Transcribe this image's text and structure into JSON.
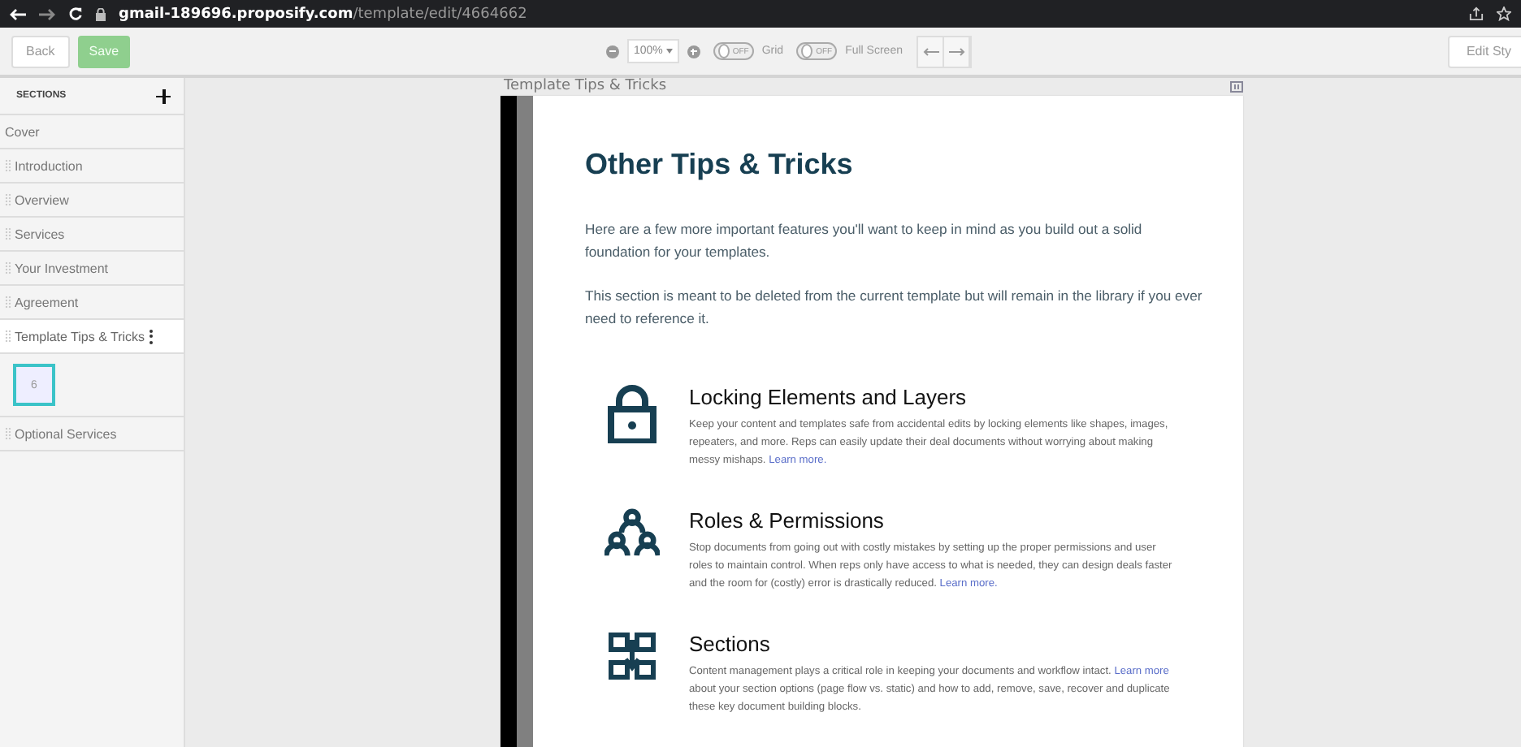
{
  "browser": {
    "url_host": "gmail-189696.proposify.com",
    "url_path": "/template/edit/4664662"
  },
  "toolbar": {
    "back": "Back",
    "save": "Save",
    "zoom": "100%",
    "grid": {
      "label": "Grid",
      "toggle": "OFF",
      "on": false
    },
    "fullscreen": {
      "label": "Full Screen",
      "toggle": "OFF",
      "on": false
    },
    "edit_style": "Edit Sty"
  },
  "sidebar": {
    "title": "SECTIONS",
    "items": [
      {
        "label": "Cover",
        "selected": false,
        "draggable": false
      },
      {
        "label": "Introduction",
        "selected": false,
        "draggable": true
      },
      {
        "label": "Overview",
        "selected": false,
        "draggable": true
      },
      {
        "label": "Services",
        "selected": false,
        "draggable": true
      },
      {
        "label": "Your Investment",
        "selected": false,
        "draggable": true
      },
      {
        "label": "Agreement",
        "selected": false,
        "draggable": true
      },
      {
        "label": "Template Tips & Tricks",
        "selected": true,
        "draggable": true,
        "page_count": "6"
      },
      {
        "label": "Optional Services",
        "selected": false,
        "draggable": true
      }
    ]
  },
  "page": {
    "section_label": "Template Tips & Tricks",
    "title": "Other Tips & Tricks",
    "intro": [
      "Here are a few more important features you'll want to keep in mind as you build out a solid foundation for your templates.",
      "This section is meant to be deleted from the current template but will remain in the library if you ever need to reference it."
    ],
    "features": [
      {
        "kind": "lock",
        "title": "Locking Elements and Layers",
        "before": "Keep your content and templates safe from accidental edits by locking elements like shapes, images, repeaters, and more.  Reps can easily update their deal documents without worrying about making messy mishaps. ",
        "link": "Learn more."
      },
      {
        "kind": "roles",
        "title": "Roles & Permissions",
        "before": "Stop documents from going out with costly mistakes by setting up the proper permissions and user roles to maintain control. When reps only have access to what is needed, they can design deals faster and the room for (costly) error is drastically reduced. ",
        "link": "Learn more."
      },
      {
        "kind": "sections",
        "title": "Sections",
        "before": "Content management plays a critical role in keeping your documents and workflow intact. ",
        "link": "Learn more",
        "after": " about your section options (page flow vs. static) and how to add, remove, save, recover and duplicate these key document building blocks."
      }
    ]
  }
}
